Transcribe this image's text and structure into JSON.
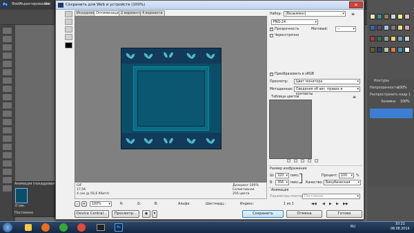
{
  "ps": {
    "logo": "Ps",
    "menu": [
      "Файл",
      "Редактирование",
      "Изо"
    ]
  },
  "dialog": {
    "title": "Сохранить для Web и устройств (100%)",
    "close": "✕",
    "tabs": [
      "Исходное",
      "Оптимизация",
      "2 варианта",
      "4 варианта"
    ],
    "info_left": [
      "GIF",
      "17,5K",
      "4 сек @ 56,6 Кбит/с"
    ],
    "info_right": [
      "Дизеринг:100%",
      "Селективная",
      "256 цвета"
    ],
    "zoom": "100%",
    "readouts": [
      "R:",
      "G:",
      "B:",
      "Альфа:",
      "Шестнадц.:",
      "Индекс:"
    ],
    "buttons": {
      "device_central": "Device Central...",
      "preview": "Просмотр...",
      "save": "Сохранить",
      "cancel": "Отмена",
      "done": "Готово"
    },
    "settings": {
      "preset_label": "Набор:",
      "preset_value": "[Безымянн]",
      "format_value": "PNG-24",
      "transparency_label": "Прозрачность",
      "transparency_checked": true,
      "matte_label": "Матовый:",
      "matte_value": "--",
      "interlaced_label": "Чересстрочно",
      "interlaced_checked": false,
      "srgb_label": "Преобразовать в sRGB",
      "srgb_checked": true,
      "preview_label": "Просмотр:",
      "preview_value": "Цвет монитора",
      "metadata_label": "Метаданные:",
      "metadata_value": "Сведения об авт. правах и контакты",
      "color_table_label": "Таблица цветов",
      "image_size_label": "Размер изображения",
      "w_label": "Ш:",
      "w_value": "320",
      "h_label": "В:",
      "h_value": "356",
      "px": "пикс.",
      "percent_label": "Процент:",
      "percent_value": "100",
      "pct": "%",
      "quality_label": "Качество:",
      "quality_value": "Бикубическая",
      "animation_label": "Анимация",
      "loop_label": "Параметры повторов:",
      "loop_value": "Постоянно",
      "frame_counter": "1 из 1"
    }
  },
  "panels": {
    "layers_label": "Контуры",
    "opacity_label": "Непрозрачность:",
    "opacity_value": "100%",
    "fill_label": "Заливка:",
    "fill_value": "100%",
    "frame_label": "Распространить кадр 1"
  },
  "animation_panel": {
    "title": "Анимация (покадровая)",
    "frame_time": "0 сек.",
    "loop": "Постоянно"
  },
  "taskbar": {
    "lang": "RU",
    "time": "10:21",
    "date": "08.08.2014"
  },
  "colors": {
    "accent": "#0b4f66",
    "highlight": "#4db8c8"
  }
}
